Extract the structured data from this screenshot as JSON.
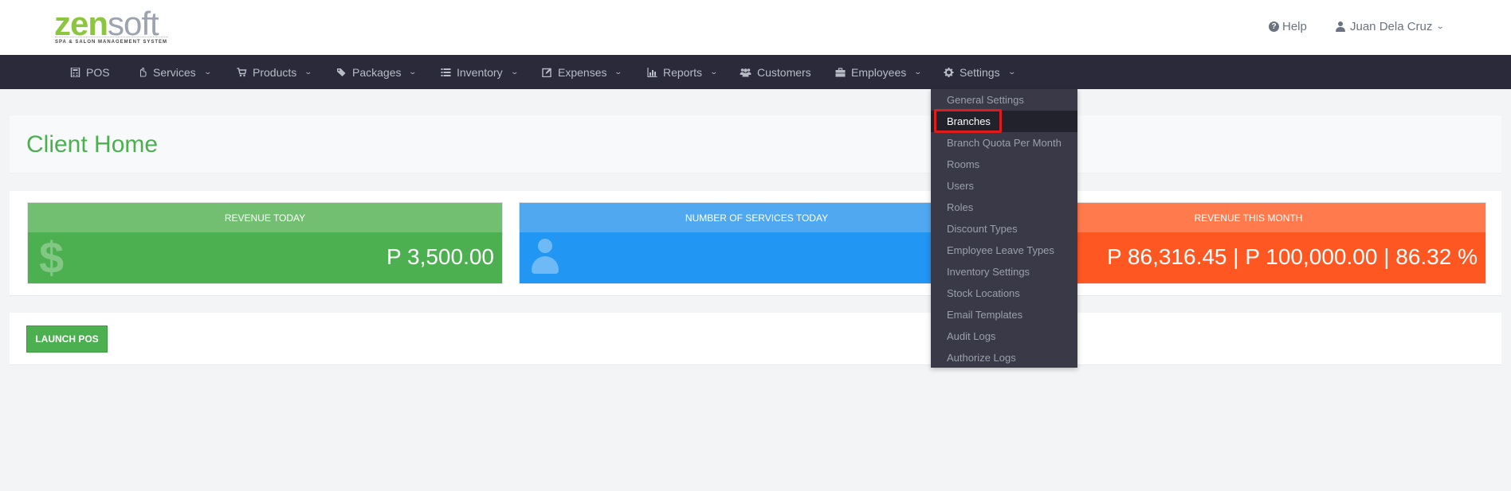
{
  "header": {
    "logo": {
      "zen": "zen",
      "soft": "soft",
      "tagline": "SPA & SALON MANAGEMENT SYSTEM"
    },
    "help_label": "Help",
    "help_icon": "question-circle-icon",
    "user_name": "Juan Dela Cruz",
    "user_icon": "user-icon",
    "user_caret": "chevron-down-icon"
  },
  "nav": {
    "items": [
      {
        "label": "POS",
        "icon": "calculator-icon",
        "has_caret": false
      },
      {
        "label": "Services",
        "icon": "hand-icon",
        "has_caret": true
      },
      {
        "label": "Products",
        "icon": "cart-icon",
        "has_caret": true
      },
      {
        "label": "Packages",
        "icon": "tags-icon",
        "has_caret": true
      },
      {
        "label": "Inventory",
        "icon": "list-icon",
        "has_caret": true
      },
      {
        "label": "Expenses",
        "icon": "edit-icon",
        "has_caret": true
      },
      {
        "label": "Reports",
        "icon": "bar-chart-icon",
        "has_caret": true
      },
      {
        "label": "Customers",
        "icon": "users-icon",
        "has_caret": false
      },
      {
        "label": "Employees",
        "icon": "briefcase-icon",
        "has_caret": true
      },
      {
        "label": "Settings",
        "icon": "gear-icon",
        "has_caret": true,
        "open": true
      }
    ]
  },
  "settings_menu": {
    "items": [
      "General Settings",
      "Branches",
      "Branch Quota Per Month",
      "Rooms",
      "Users",
      "Roles",
      "Discount Types",
      "Employee Leave Types",
      "Inventory Settings",
      "Stock Locations",
      "Email Templates",
      "Audit Logs",
      "Authorize Logs"
    ],
    "active_item": "Branches"
  },
  "page": {
    "title": "Client Home"
  },
  "stats": {
    "revenue_today": {
      "label": "REVENUE TODAY",
      "value": "P 3,500.00",
      "icon": "dollar-icon"
    },
    "services_today": {
      "label": "NUMBER OF SERVICES TODAY",
      "value": "",
      "icon": "person-icon"
    },
    "revenue_month": {
      "label": "REVENUE THIS MONTH",
      "value": "P 86,316.45 | P 100,000.00 | 86.32 %"
    }
  },
  "actions": {
    "launch_pos_label": "LAUNCH POS"
  },
  "colors": {
    "brand_green": "#8cc63f",
    "title_green": "#4caf50",
    "navbar": "#2a2a3a",
    "dropdown": "#393947",
    "stat_green": "#4caf50",
    "stat_blue": "#2196f3",
    "stat_orange": "#ff5722",
    "highlight_red": "#e01b1b"
  }
}
